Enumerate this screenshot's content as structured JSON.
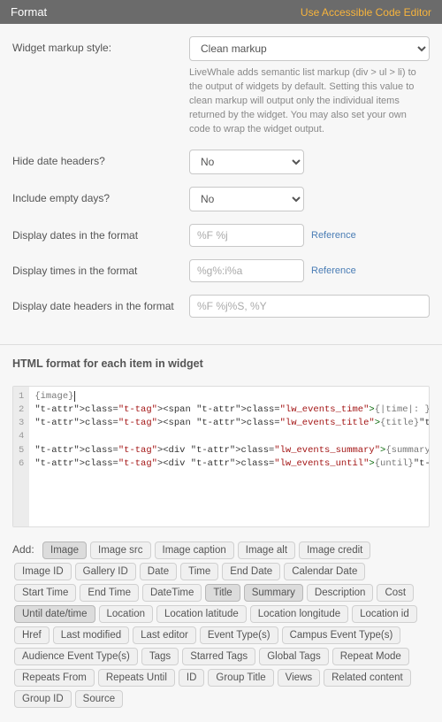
{
  "header": {
    "title": "Format",
    "editor_link": "Use Accessible Code Editor"
  },
  "rows": {
    "markup_style": {
      "label": "Widget markup style:",
      "value": "Clean markup",
      "help": "LiveWhale adds semantic list markup (div > ul > li) to the output of widgets by default. Setting this value to clean markup will output only the individual items returned by the widget. You may also set your own code to wrap the widget output."
    },
    "hide_date_headers": {
      "label": "Hide date headers?",
      "value": "No"
    },
    "include_empty_days": {
      "label": "Include empty days?",
      "value": "No"
    },
    "date_format": {
      "label": "Display dates in the format",
      "placeholder": "%F %j",
      "reference": "Reference"
    },
    "time_format": {
      "label": "Display times in the format",
      "placeholder": "%g%:i%a",
      "reference": "Reference"
    },
    "header_format": {
      "label": "Display date headers in the format",
      "placeholder": "%F %j%S, %Y"
    }
  },
  "html_format": {
    "title": "HTML format for each item in widget",
    "lines": [
      "{image}|",
      "<span class=\"lw_events_time\">{|time|: }</span>",
      "<span class=\"lw_events_title\">{title}</span>",
      "",
      "<div class=\"lw_events_summary\">{summary}</div>",
      "<div class=\"lw_events_until\">{until}</div>"
    ]
  },
  "add": {
    "label": "Add:",
    "tags": [
      {
        "t": "Image",
        "s": true
      },
      {
        "t": "Image src"
      },
      {
        "t": "Image caption"
      },
      {
        "t": "Image alt"
      },
      {
        "t": "Image credit"
      },
      {
        "t": "Image ID"
      },
      {
        "t": "Gallery ID"
      },
      {
        "t": "Date"
      },
      {
        "t": "Time"
      },
      {
        "t": "End Date"
      },
      {
        "t": "Calendar Date"
      },
      {
        "t": "Start Time"
      },
      {
        "t": "End Time"
      },
      {
        "t": "DateTime"
      },
      {
        "t": "Title",
        "s": true
      },
      {
        "t": "Summary",
        "s": true
      },
      {
        "t": "Description"
      },
      {
        "t": "Cost"
      },
      {
        "t": "Until date/time",
        "s": true
      },
      {
        "t": "Location"
      },
      {
        "t": "Location latitude"
      },
      {
        "t": "Location longitude"
      },
      {
        "t": "Location id"
      },
      {
        "t": "Href"
      },
      {
        "t": "Last modified"
      },
      {
        "t": "Last editor"
      },
      {
        "t": "Event Type(s)"
      },
      {
        "t": "Campus Event Type(s)"
      },
      {
        "t": "Audience Event Type(s)"
      },
      {
        "t": "Tags"
      },
      {
        "t": "Starred Tags"
      },
      {
        "t": "Global Tags"
      },
      {
        "t": "Repeat Mode"
      },
      {
        "t": "Repeats From"
      },
      {
        "t": "Repeats Until"
      },
      {
        "t": "ID"
      },
      {
        "t": "Group Title"
      },
      {
        "t": "Views"
      },
      {
        "t": "Related content"
      },
      {
        "t": "Group ID"
      },
      {
        "t": "Source"
      }
    ]
  }
}
